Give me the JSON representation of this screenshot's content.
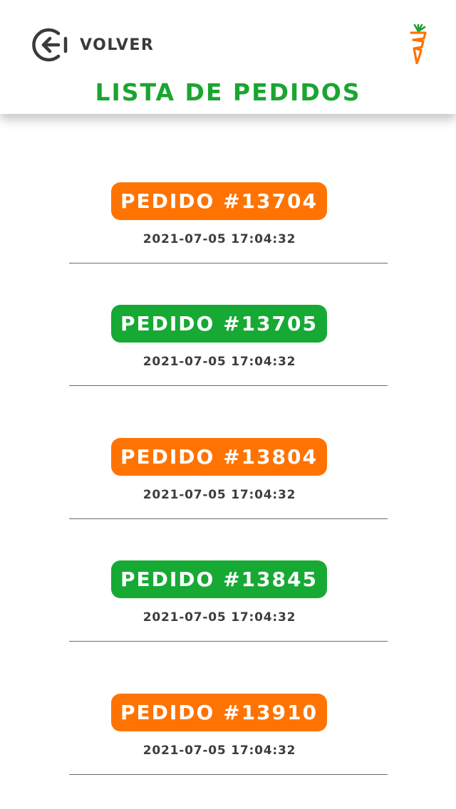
{
  "header": {
    "back_label": "VOLVER",
    "title": "LISTA DE PEDIDOS"
  },
  "colors": {
    "title_green": "#1aa531",
    "orange": "#ff7302",
    "green": "#16a934",
    "text_dark": "#3d3d3d"
  },
  "icons": {
    "back": "back-arrow-circle-icon",
    "logo": "carrot-logo-icon"
  },
  "orders": [
    {
      "label": "PEDIDO #13704",
      "date": "2021-07-05 17:04:32",
      "status_color": "orange"
    },
    {
      "label": "PEDIDO #13705",
      "date": "2021-07-05 17:04:32",
      "status_color": "green"
    },
    {
      "label": "PEDIDO #13804",
      "date": "2021-07-05 17:04:32",
      "status_color": "orange"
    },
    {
      "label": "PEDIDO #13845",
      "date": "2021-07-05 17:04:32",
      "status_color": "green"
    },
    {
      "label": "PEDIDO #13910",
      "date": "2021-07-05 17:04:32",
      "status_color": "orange"
    }
  ]
}
